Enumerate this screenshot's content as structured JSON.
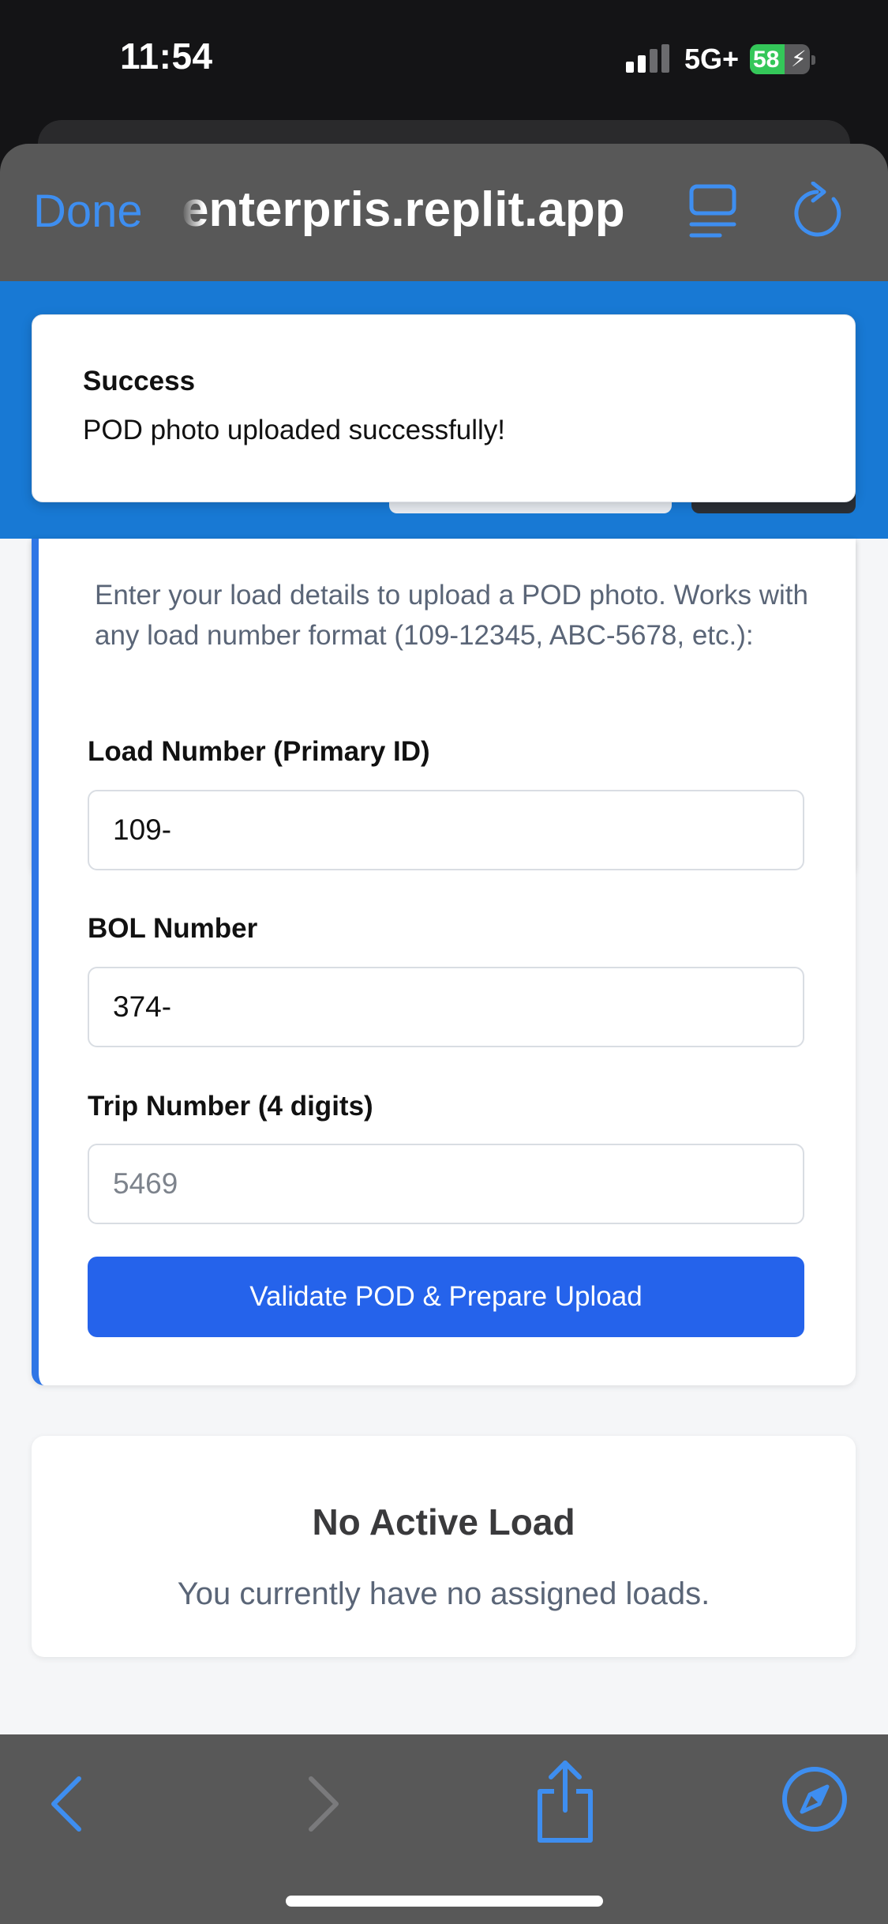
{
  "status_bar": {
    "time": "11:54",
    "network": "5G+",
    "battery_percent": "58",
    "battery_level": 0.58,
    "signal_bars_active": 2,
    "signal_bars_total": 4
  },
  "browser": {
    "done_label": "Done",
    "url": "enterpris.replit.app",
    "reader_icon": "reader-view-icon",
    "reload_icon": "reload-icon",
    "accent_color": "#3e8ef0"
  },
  "toast": {
    "title": "Success",
    "message": "POD photo uploaded successfully!"
  },
  "pod_form": {
    "intro": "Enter your load details to upload a POD photo. Works with any load number format (109-12345, ABC-5678, etc.):",
    "load_number": {
      "label": "Load Number (Primary ID)",
      "value": "109-",
      "placeholder": ""
    },
    "bol_number": {
      "label": "BOL Number",
      "value": "374-",
      "placeholder": ""
    },
    "trip_number": {
      "label": "Trip Number (4 digits)",
      "value": "",
      "placeholder": "5469"
    },
    "submit_label": "Validate POD & Prepare Upload",
    "button_color": "#2563eb",
    "header_color": "#1879d4"
  },
  "active_load": {
    "title": "No Active Load",
    "message": "You currently have no assigned loads."
  },
  "toolbar": {
    "icons": [
      "back-icon",
      "forward-icon",
      "share-icon",
      "compass-icon"
    ]
  }
}
